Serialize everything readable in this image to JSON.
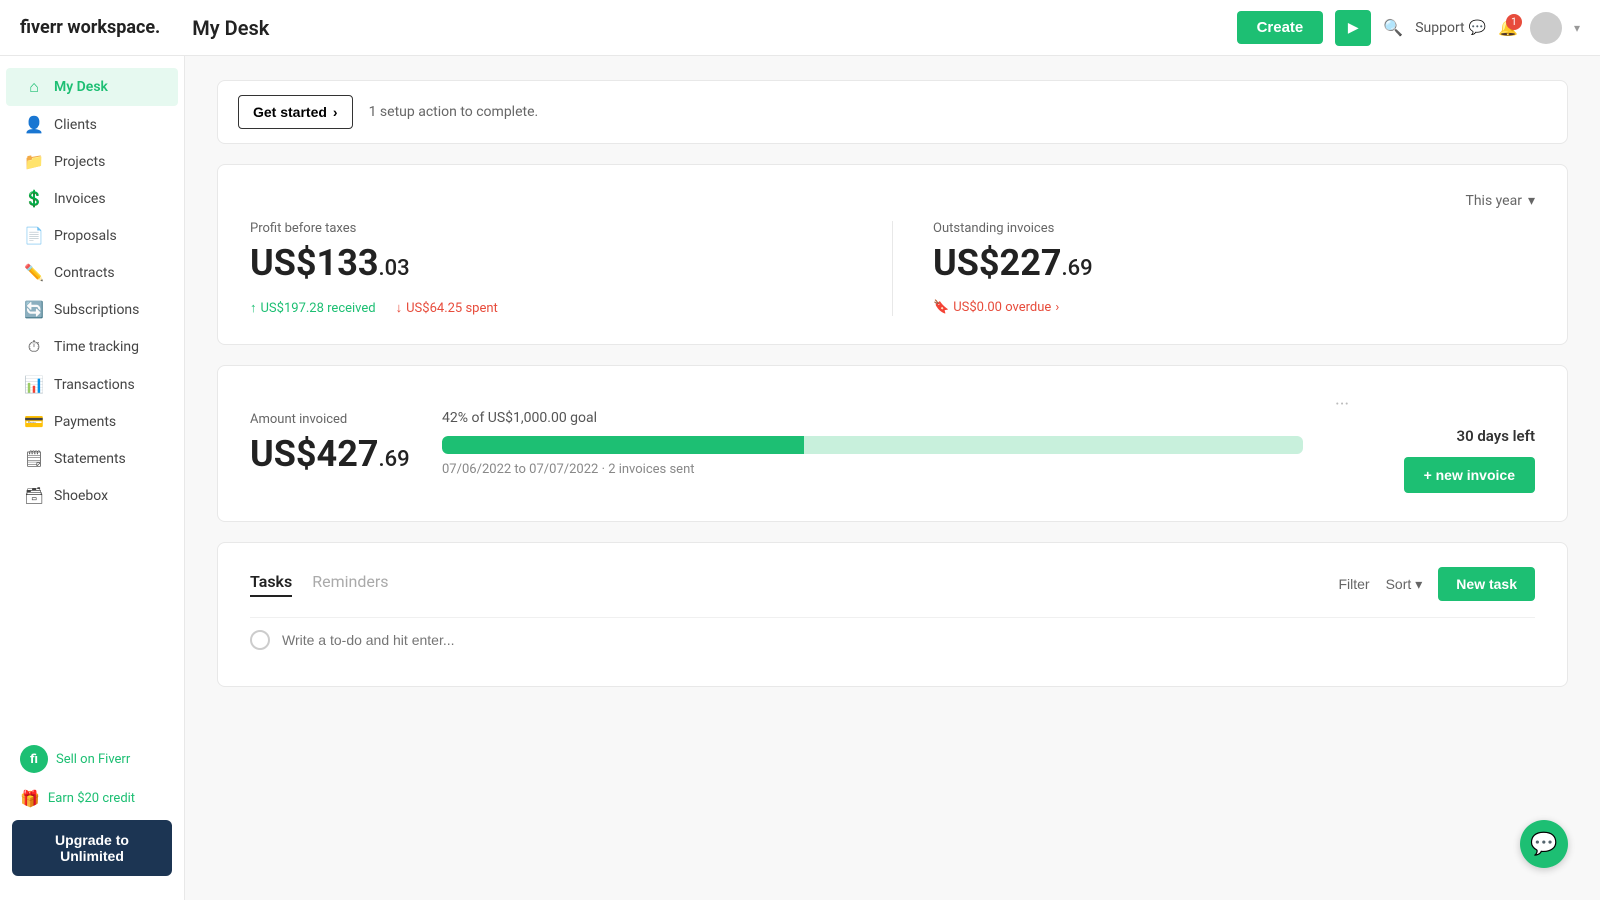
{
  "app": {
    "logo_text": "fiverr workspace.",
    "page_title": "My Desk"
  },
  "topbar": {
    "create_label": "Create",
    "play_icon": "▶",
    "search_placeholder": "Search",
    "support_label": "Support",
    "notification_count": "1"
  },
  "sidebar": {
    "items": [
      {
        "id": "my-desk",
        "label": "My Desk",
        "icon": "⌂",
        "active": true
      },
      {
        "id": "clients",
        "label": "Clients",
        "icon": "👤"
      },
      {
        "id": "projects",
        "label": "Projects",
        "icon": "📁"
      },
      {
        "id": "invoices",
        "label": "Invoices",
        "icon": "💲"
      },
      {
        "id": "proposals",
        "label": "Proposals",
        "icon": "📄"
      },
      {
        "id": "contracts",
        "label": "Contracts",
        "icon": "✏️"
      },
      {
        "id": "subscriptions",
        "label": "Subscriptions",
        "icon": "🔄"
      },
      {
        "id": "time-tracking",
        "label": "Time tracking",
        "icon": "⏱"
      },
      {
        "id": "transactions",
        "label": "Transactions",
        "icon": "📊"
      },
      {
        "id": "payments",
        "label": "Payments",
        "icon": "💳"
      },
      {
        "id": "statements",
        "label": "Statements",
        "icon": "🗒"
      },
      {
        "id": "shoebox",
        "label": "Shoebox",
        "icon": "🗃"
      }
    ],
    "sell_label": "Sell on Fiverr",
    "earn_label": "Earn $20 credit",
    "upgrade_label": "Upgrade to Unlimited"
  },
  "get_started": {
    "button_label": "Get started",
    "arrow": "›",
    "setup_text": "1 setup action to complete."
  },
  "profit_card": {
    "label": "Profit before taxes",
    "value_main": "US$133",
    "value_cents": ".03",
    "year_filter": "This year",
    "received_label": "US$197.28 received",
    "spent_label": "US$64.25 spent",
    "outstanding_label": "Outstanding invoices",
    "outstanding_main": "US$227",
    "outstanding_cents": ".69",
    "overdue_label": "US$0.00 overdue"
  },
  "goal_card": {
    "label": "Amount invoiced",
    "value_main": "US$427",
    "value_cents": ".69",
    "pct_text": "42% of US$1,000.00 goal",
    "progress_pct": 42,
    "dates_text": "07/06/2022 to 07/07/2022 · 2 invoices sent",
    "days_left": "30 days left",
    "new_invoice_label": "+ new invoice"
  },
  "tasks": {
    "tab_tasks": "Tasks",
    "tab_reminders": "Reminders",
    "filter_label": "Filter",
    "sort_label": "Sort",
    "new_task_label": "New task",
    "input_placeholder": "Write a to-do and hit enter..."
  }
}
